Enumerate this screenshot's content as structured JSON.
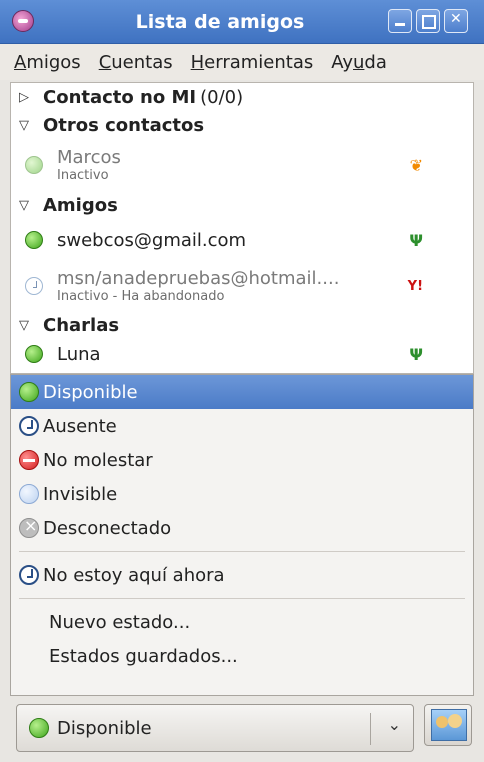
{
  "window": {
    "title": "Lista de amigos"
  },
  "menu": [
    {
      "label": "Amigos",
      "mnemonic": "A",
      "rest": "migos"
    },
    {
      "label": "Cuentas",
      "mnemonic": "C",
      "rest": "uentas"
    },
    {
      "label": "Herramientas",
      "mnemonic": "H",
      "rest": "erramientas"
    },
    {
      "label": "Ayuda",
      "pre": "Ay",
      "mnemonic": "u",
      "rest": "da"
    }
  ],
  "buddylist": {
    "groups": [
      {
        "name": "Contacto no MI",
        "count": "(0/0)",
        "expanded": false
      },
      {
        "name": "Otros contactos",
        "expanded": true
      },
      {
        "name": "Amigos",
        "expanded": true
      },
      {
        "name": "Charlas",
        "expanded": true
      }
    ],
    "contacts": {
      "marcos": {
        "name": "Marcos",
        "status": "Inactivo",
        "protocol_icon": "msn-butterfly-icon"
      },
      "swebcos": {
        "name": "swebcos@gmail.com",
        "protocol_icon": "gtalk-icon"
      },
      "msn": {
        "name": "msn/anadepruebas@hotmail....",
        "status": "Inactivo - Ha abandonado",
        "protocol_icon": "yahoo-icon"
      },
      "luna": {
        "name": "Luna",
        "protocol_icon": "gtalk-icon"
      }
    }
  },
  "status_menu": {
    "items": [
      {
        "label": "Disponible",
        "icon": "available-icon",
        "selected": true
      },
      {
        "label": "Ausente",
        "icon": "away-icon"
      },
      {
        "label": "No molestar",
        "icon": "busy-icon"
      },
      {
        "label": "Invisible",
        "icon": "invisible-icon"
      },
      {
        "label": "Desconectado",
        "icon": "offline-icon"
      }
    ],
    "saved": [
      {
        "label": "No estoy aquí ahora",
        "icon": "away-icon"
      }
    ],
    "actions": [
      {
        "label": "Nuevo estado..."
      },
      {
        "label": "Estados guardados..."
      }
    ]
  },
  "status_selector": {
    "value": "Disponible"
  },
  "colors": {
    "accent": "#4b7bc7",
    "titlebar": "#3f72c1"
  }
}
